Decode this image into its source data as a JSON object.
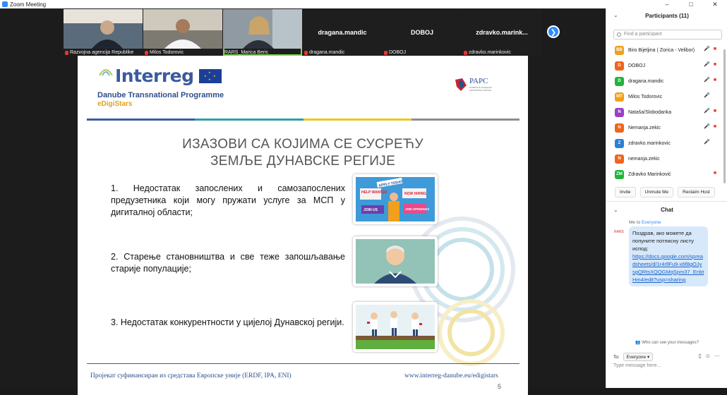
{
  "window": {
    "title": "Zoom Meeting",
    "controls": [
      "–",
      "□",
      "✕"
    ]
  },
  "gallery": {
    "tiles": [
      {
        "big": "",
        "label": "Razvojna agencija Republike",
        "video": true,
        "bg": "#5a6b7c"
      },
      {
        "big": "",
        "label": "Milos Todorovic",
        "video": true,
        "bg": "#7d7a72"
      },
      {
        "big": "",
        "label": "RARS_Marica Beric",
        "video": true,
        "bg": "#8f9aa3",
        "active": true
      },
      {
        "big": "dragana.mandic",
        "label": "dragana.mandic",
        "video": false
      },
      {
        "big": "DOBOJ",
        "label": "DOBOJ",
        "video": false
      },
      {
        "big": "zdravko.marink...",
        "label": "zdravko.marinkovic",
        "video": false
      }
    ],
    "next_icon": "chevron-right-icon"
  },
  "slide": {
    "logo": "Interreg",
    "programme": "Danube Transnational Programme",
    "project": "eDigiStars",
    "partner_logo": "PAPC",
    "partner_sub": "РАЗВОЈНА АГЕНЦИЈА РЕПУБЛИКЕ СРПСКЕ",
    "bar_colors": [
      "#3c5a9e",
      "#2aa0a8",
      "#e9c91f",
      "#8d8d8d"
    ],
    "title_line1": "ИЗАЗОВИ СА КОЈИМА СЕ СУСРЕЋУ",
    "title_line2": "ЗЕМЉЕ ДУНАВСКЕ РЕГИЈЕ",
    "items": [
      "1. Недостатак запослених и самозапослених предузетника који могу пружати услуге за МСП у дигиталној области;",
      "2. Старење становништва и све теже запошљавање старије популације;",
      "3. Недостатак конкурентности у цијелој Дунавској регији."
    ],
    "footer_left": "Пројекат суфинансиран из средстава Европске уније (ERDF, IPA, ENI)",
    "footer_right": "www.interreg-danube.eu/edigistars",
    "page": "5",
    "image1_signs": [
      "APPLY TODAY",
      "HELP WANTED",
      "NOW HIRING",
      "JOIN US",
      "JOB OPENINGS"
    ]
  },
  "participants": {
    "header": "Participants (11)",
    "search_placeholder": "Find a participant",
    "list": [
      {
        "initials": "BB",
        "name": "Biro Bijeljina ( Zorica - Velibor)",
        "color": "#f0a01c",
        "mic": true,
        "cam": true
      },
      {
        "initials": "D",
        "name": "DOBOJ",
        "color": "#f0641c",
        "mic": true,
        "cam": true
      },
      {
        "initials": "D",
        "name": "dragana.mandic",
        "color": "#1fb53a",
        "mic": true,
        "cam": true
      },
      {
        "initials": "MT",
        "name": "Milos Todorovic",
        "color": "#f0a01c",
        "mic": true,
        "cam": false
      },
      {
        "initials": "N",
        "name": "Nataša/Slobodanka",
        "color": "#9b3fc8",
        "mic": true,
        "cam": true
      },
      {
        "initials": "N",
        "name": "Nemanja.zekic",
        "color": "#f0641c",
        "mic": true,
        "cam": true
      },
      {
        "initials": "Z",
        "name": "zdravko.marinkovic",
        "color": "#2d7fd0",
        "mic": true,
        "cam": false
      },
      {
        "initials": "N",
        "name": "nemanja.zekic",
        "color": "#f0641c",
        "mic": false,
        "cam": false
      },
      {
        "initials": "ZM",
        "name": "Zdravko Marinković",
        "color": "#1fb53a",
        "mic": false,
        "cam": true
      }
    ],
    "buttons": [
      "Invite",
      "Unmute Me",
      "Reclaim Host"
    ]
  },
  "chat": {
    "header": "Chat",
    "from": "Me to",
    "to": "Everyone",
    "message": "Поздрав, ако можете да попуните потписну листу испод:",
    "link": "https://docs.google.com/spreadsheets/d/1r4rllFu9-x6f8gOJysgQRtsXQQGMqSpm37_EnbtHm4/edit?usp=sharing",
    "who_can_see": "Who can see your messages?",
    "to_label": "To:",
    "to_value": "Everyone",
    "input_placeholder": "Type message here..."
  }
}
